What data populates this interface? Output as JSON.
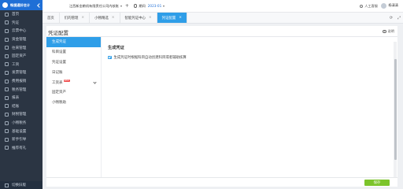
{
  "brand": {
    "name": "畅捷通好会计"
  },
  "sidebar": {
    "items": [
      {
        "label": "首页",
        "icon": "home-icon"
      },
      {
        "label": "凭证",
        "icon": "voucher-icon"
      },
      {
        "label": "云票中心",
        "icon": "cloud-invoice-icon"
      },
      {
        "label": "资金管理",
        "icon": "fund-icon"
      },
      {
        "label": "往来管理",
        "icon": "contacts-icon"
      },
      {
        "label": "固定资产",
        "icon": "asset-icon"
      },
      {
        "label": "工资",
        "icon": "salary-icon"
      },
      {
        "label": "发票管理",
        "icon": "invoice-icon"
      },
      {
        "label": "费用报销",
        "icon": "expense-icon"
      },
      {
        "label": "税务管理",
        "icon": "tax-icon"
      },
      {
        "label": "报表",
        "icon": "report-icon"
      },
      {
        "label": "结账",
        "icon": "closing-icon"
      },
      {
        "label": "财税管理",
        "icon": "finance-tax-icon"
      },
      {
        "label": "小畅税务",
        "icon": "xiaochang-icon"
      },
      {
        "label": "基础设置",
        "icon": "settings-icon"
      },
      {
        "label": "新手引导",
        "icon": "guide-icon"
      },
      {
        "label": "推荐有礼",
        "icon": "gift-icon"
      }
    ],
    "bottom_label": "切换旧版"
  },
  "topbar": {
    "company": "江西新金粮机有限责任公司内核账",
    "plus": "+",
    "period_label": "期间",
    "period_value": "2023-01",
    "service_label": "人工客服",
    "user_name": "杨清清"
  },
  "tabs": [
    {
      "label": "首页",
      "closable": false
    },
    {
      "label": "们的管理",
      "closable": true
    },
    {
      "label": "小畅精选",
      "closable": true
    },
    {
      "label": "智能凭证中心",
      "closable": true
    },
    {
      "label": "凭证配置",
      "closable": true,
      "active": true
    }
  ],
  "tab_controls": {
    "refresh": "⟳",
    "expand": "⤢"
  },
  "page": {
    "title": "凭证配置",
    "help_label": "说明",
    "menu": [
      {
        "label": "生成凭证",
        "active": true
      },
      {
        "label": "科目设置"
      },
      {
        "label": "凭证设置"
      },
      {
        "label": "日记账"
      },
      {
        "label": "工资表",
        "badge": "NEW",
        "expandable": true
      },
      {
        "label": "固定资产"
      },
      {
        "label": "小畅税助"
      }
    ],
    "section_title": "生成凭证",
    "option_label": "生成凭证时根据科目自动创建科目或者辅助核算",
    "option_checked": true,
    "save_label": "保存"
  },
  "colors": {
    "accent": "#2f9ee8",
    "sidebar_bg": "#2b3543",
    "brand_bg": "#1f6fd6",
    "save_btn": "#7cc42b"
  }
}
